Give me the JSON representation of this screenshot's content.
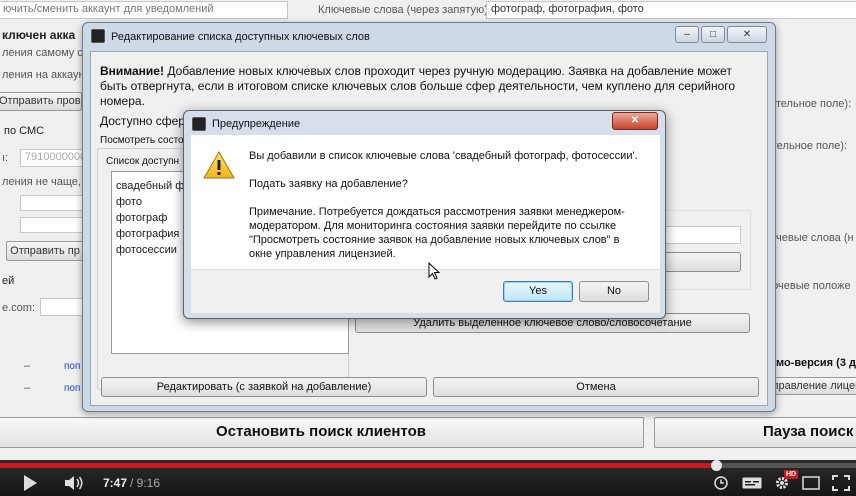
{
  "background": {
    "left_texts": [
      {
        "id": "bg-notify-toggle",
        "text": "ючить/сменить аккаунт для уведомлений"
      },
      {
        "id": "bg-account-header",
        "text": "ключен акка"
      },
      {
        "id": "bg-send-self",
        "text": "ления самому се"
      },
      {
        "id": "bg-send-account",
        "text": "ления на аккаун"
      },
      {
        "id": "bg-send-btn",
        "text": "Отправить прове"
      },
      {
        "id": "bg-sms",
        "text": "по СМС"
      },
      {
        "id": "bg-phone-label",
        "text": "ı:"
      },
      {
        "id": "bg-phone-value",
        "text": "7910000000"
      },
      {
        "id": "bg-notify-freq",
        "text": "ления не чаще,"
      },
      {
        "id": "bg-send-btn2",
        "text": "Отправить пр"
      },
      {
        "id": "bg-ei",
        "text": "ей"
      },
      {
        "id": "bg-ecom",
        "text": "e.com:"
      },
      {
        "id": "bg-dash1",
        "text": "–"
      },
      {
        "id": "bg-dash2",
        "text": "–"
      },
      {
        "id": "bg-link1",
        "text": "поп"
      },
      {
        "id": "bg-link2",
        "text": "поп"
      }
    ],
    "right_texts": [
      {
        "id": "bg-keywords-label",
        "text": "Ключевые слова (через запятую):"
      },
      {
        "id": "bg-keywords-value",
        "text": "фотограф, фотография, фото"
      },
      {
        "id": "bg-field1",
        "text": "ательное поле):"
      },
      {
        "id": "bg-field2",
        "text": "ательное поле):"
      },
      {
        "id": "bg-kw2",
        "text": "ючевые слова (н"
      },
      {
        "id": "bg-neg",
        "text": "ючевые положе"
      },
      {
        "id": "bg-demo",
        "text": "емо-версия (3 д"
      },
      {
        "id": "bg-license",
        "text": "управление лицензи"
      }
    ],
    "bottom_buttons": {
      "stop": "Остановить поиск клиентов",
      "pause": "Пауза поиск"
    }
  },
  "edit_dialog": {
    "title": "Редактирование списка доступных ключевых слов",
    "warning_bold": "Внимание!",
    "warning_text": " Добавление новых ключевых слов проходит через ручную модерацию. Заявка на добавление может быть отвергнута, если в итоговом списке ключевых слов больше сфер деятельности, чем куплено для серийного номера.",
    "available_label": "Доступно сфер",
    "view_status_label": "Посмотреть состо",
    "list_label": "Список доступн",
    "keywords": [
      "свадебный фо",
      "фото",
      "фотограф",
      "фотография",
      "фотосессии"
    ],
    "delete_button": "Удалить выделенное ключевое слово/словосочетание",
    "edit_button": "Редактировать (с заявкой на добавление)",
    "cancel_button": "Отмена"
  },
  "warning_dialog": {
    "title": "Предупреждение",
    "line1": "Вы добавили в список ключевые слова 'свадебный фотограф, фотосессии'.",
    "line2": "Подать заявку на добавление?",
    "note": "Примечание. Потребуется дождаться рассмотрения заявки менеджером-модератором. Для мониторинга состояния заявки перейдите по ссылке \"Просмотреть состояние заявок на добавление новых ключевых слов\" в окне управления лицензией.",
    "yes": "Yes",
    "no": "No"
  },
  "player": {
    "current_time": "7:47",
    "duration": "/ 9:16",
    "progress": 0.836,
    "hd_badge": "HD",
    "accent": "#cc181e"
  },
  "icons": {
    "play": "play-icon",
    "volume": "volume-icon",
    "clock": "watch-later-icon",
    "captions": "captions-icon",
    "settings": "gear-icon",
    "theater": "theater-mode-icon",
    "fullscreen": "fullscreen-icon",
    "warning": "warning-triangle-icon"
  }
}
